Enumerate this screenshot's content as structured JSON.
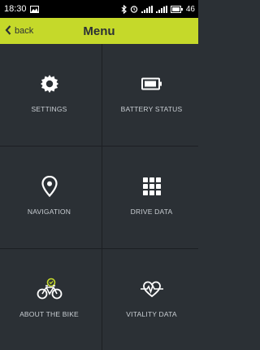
{
  "status_bar": {
    "time": "18:30",
    "battery_level": "46",
    "icons": [
      "gallery-icon",
      "bluetooth-icon",
      "alarm-icon",
      "signal-icon",
      "signal-icon",
      "battery-icon"
    ]
  },
  "header": {
    "back_label": "back",
    "title": "Menu",
    "accent_color": "#c5d92a"
  },
  "menu": {
    "items": [
      {
        "label": "SETTINGS",
        "icon": "gear-icon"
      },
      {
        "label": "BATTERY STATUS",
        "icon": "battery-icon"
      },
      {
        "label": "NAVIGATION",
        "icon": "location-pin-icon"
      },
      {
        "label": "DRIVE DATA",
        "icon": "grid-icon"
      },
      {
        "label": "ABOUT THE BIKE",
        "icon": "bike-icon"
      },
      {
        "label": "VITALITY DATA",
        "icon": "heartbeat-icon"
      }
    ]
  }
}
